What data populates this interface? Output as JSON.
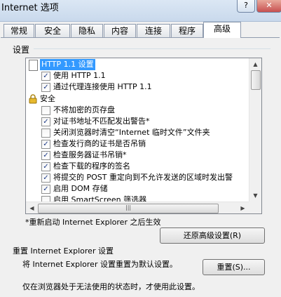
{
  "window": {
    "title": "Internet 选项",
    "help_glyph": "?",
    "close_glyph": "✕"
  },
  "tabs": [
    {
      "label": "常规"
    },
    {
      "label": "安全"
    },
    {
      "label": "隐私"
    },
    {
      "label": "内容"
    },
    {
      "label": "连接"
    },
    {
      "label": "程序"
    },
    {
      "label": "高级",
      "active": true
    }
  ],
  "settings": {
    "group_label": "设置",
    "rows": [
      {
        "type": "header",
        "icon": "document-icon",
        "label": "HTTP 1.1 设置",
        "selected": true
      },
      {
        "type": "checkbox",
        "checked": true,
        "label": "使用 HTTP 1.1"
      },
      {
        "type": "checkbox",
        "checked": true,
        "label": "通过代理连接使用 HTTP 1.1"
      },
      {
        "type": "header",
        "icon": "lock-icon",
        "label": "安全"
      },
      {
        "type": "checkbox",
        "checked": false,
        "label": "不将加密的页存盘"
      },
      {
        "type": "checkbox",
        "checked": true,
        "label": "对证书地址不匹配发出警告*"
      },
      {
        "type": "checkbox",
        "checked": false,
        "label": "关闭浏览器时清空“Internet 临时文件”文件夹"
      },
      {
        "type": "checkbox",
        "checked": true,
        "label": "检查发行商的证书是否吊销"
      },
      {
        "type": "checkbox",
        "checked": true,
        "label": "检查服务器证书吊销*"
      },
      {
        "type": "checkbox",
        "checked": true,
        "label": "检查下载的程序的签名"
      },
      {
        "type": "checkbox",
        "checked": true,
        "label": "将提交的 POST 重定向到不允许发送的区域时发出警"
      },
      {
        "type": "checkbox",
        "checked": true,
        "label": "启用 DOM 存储"
      },
      {
        "type": "checkbox",
        "checked": false,
        "label": "启用 SmartScreen 筛选器"
      }
    ],
    "restart_note": "*重新启动 Internet Explorer 之后生效",
    "restore_button": "还原高级设置(R)"
  },
  "reset": {
    "title": "重置 Internet Explorer 设置",
    "description": "将 Internet Explorer 设置重置为默认设置。",
    "button": "重置(S)...",
    "bottom_note": "仅在浏览器处于无法使用的状态时，才使用此设置。"
  },
  "colors": {
    "selection": "#3399ff",
    "checkmark": "#1f3c88"
  }
}
